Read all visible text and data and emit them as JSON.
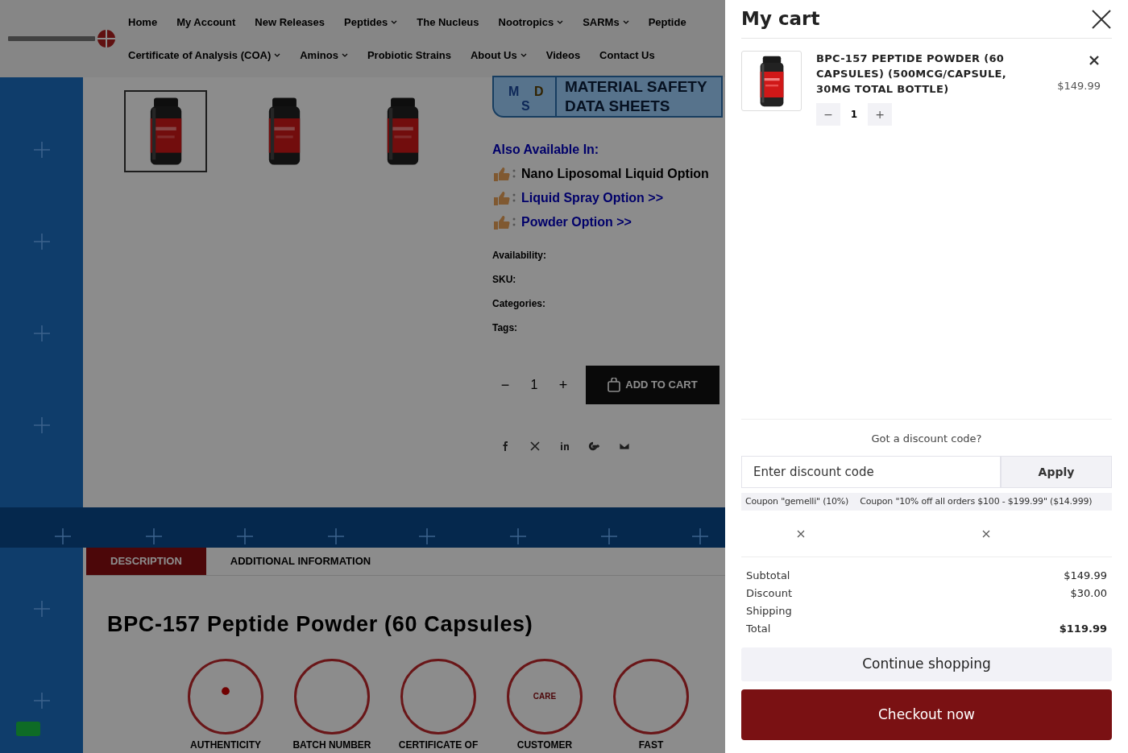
{
  "header": {
    "nav_rows": [
      [
        {
          "label": "Home",
          "dropdown": false
        },
        {
          "label": "My Account",
          "dropdown": false
        },
        {
          "label": "New Releases",
          "dropdown": false
        },
        {
          "label": "Peptides",
          "dropdown": true
        },
        {
          "label": "The Nucleus",
          "dropdown": false
        },
        {
          "label": "Nootropics",
          "dropdown": true
        },
        {
          "label": "SARMs",
          "dropdown": true
        },
        {
          "label": "Peptide",
          "dropdown": false
        }
      ],
      [
        {
          "label": "Certificate of Analysis (COA)",
          "dropdown": true
        },
        {
          "label": "Aminos",
          "dropdown": true
        },
        {
          "label": "Probiotic Strains",
          "dropdown": false
        },
        {
          "label": "About Us",
          "dropdown": true
        },
        {
          "label": "Videos",
          "dropdown": false
        },
        {
          "label": "Contact Us",
          "dropdown": false
        }
      ]
    ]
  },
  "gallery": [
    {
      "selected": true
    },
    {
      "selected": false
    },
    {
      "selected": false
    }
  ],
  "msds": {
    "letters": [
      "M",
      "D",
      "S"
    ],
    "lines": [
      "MATERIAL SAFETY",
      "DATA SHEETS"
    ]
  },
  "also_available": {
    "heading": "Also Available In:",
    "options": [
      {
        "label": "Nano Liposomal Liquid Option",
        "link": false
      },
      {
        "label": "Liquid Spray Option >>",
        "link": true
      },
      {
        "label": "Powder Option >>",
        "link": true
      }
    ]
  },
  "meta": [
    "Availability:",
    "SKU:",
    "Categories:",
    "Tags:"
  ],
  "quantity": {
    "minus": "−",
    "value": "1",
    "plus": "+"
  },
  "add_to_cart": "ADD TO CART",
  "tabs": [
    {
      "label": "DESCRIPTION",
      "selected": true
    },
    {
      "label": "ADDITIONAL INFORMATION",
      "selected": false
    }
  ],
  "product_title": "BPC-157 Peptide Powder (60 Capsules)",
  "features": [
    {
      "kind": "award",
      "label": "AUTHENTICITY"
    },
    {
      "kind": "clipboard",
      "label": "BATCH NUMBER"
    },
    {
      "kind": "document",
      "label": "CERTIFICATE OF"
    },
    {
      "kind": "headset",
      "label": "CUSTOMER",
      "inner": "CARE"
    },
    {
      "kind": "truck",
      "label": "FAST"
    }
  ],
  "cart": {
    "title": "My cart",
    "items": [
      {
        "name": "BPC-157 PEPTIDE POWDER (60 CAPSULES) (500MCG/CAPSULE, 30MG TOTAL BOTTLE)",
        "price": "$149.99",
        "minus": "−",
        "quantity": "1",
        "plus": "+"
      }
    ],
    "discount_prompt": "Got a discount code?",
    "discount_placeholder": "Enter discount code",
    "apply": "Apply",
    "coupons": [
      "Coupon \"gemelli\" (10%)",
      "Coupon \"10% off all orders $100 - $199.99\" ($14.999)"
    ],
    "totals": [
      {
        "label": "Subtotal",
        "value": "$149.99",
        "bold": false
      },
      {
        "label": "Discount",
        "value": "$30.00",
        "bold": false
      },
      {
        "label": "Shipping",
        "bold": false
      },
      {
        "label": "Total",
        "value": "$119.99",
        "bold": true
      }
    ],
    "continue": "Continue shopping",
    "checkout": "Checkout now"
  }
}
